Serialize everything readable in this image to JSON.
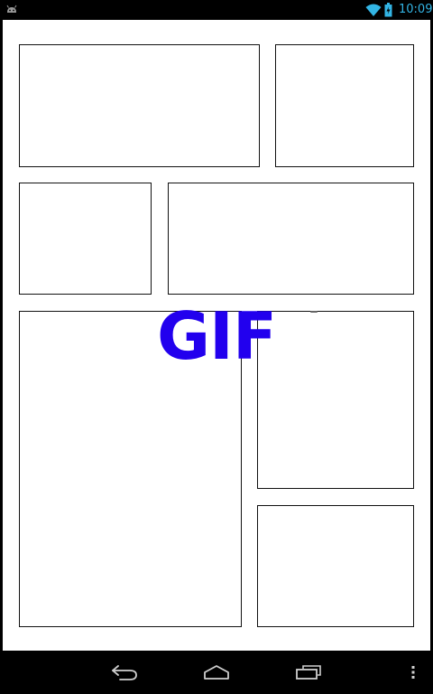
{
  "status_bar": {
    "time": "10:09",
    "notification_icon": "android-icon",
    "wifi_icon": "wifi-icon",
    "battery_icon": "battery-icon",
    "icon_color": "#33b5e5"
  },
  "canvas": {
    "overlay_text": "GIF",
    "overlay_color": "#2200ee",
    "panel_count": 7
  },
  "nav_bar": {
    "back_icon": "back-icon",
    "home_icon": "home-icon",
    "recents_icon": "recent-apps-icon",
    "menu_icon": "overflow-menu-icon"
  }
}
